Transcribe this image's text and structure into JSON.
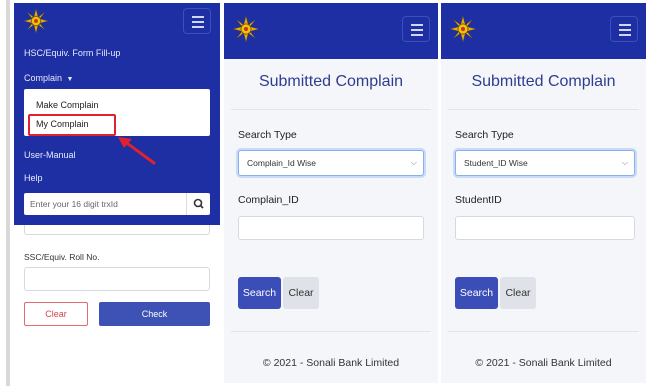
{
  "panel1": {
    "nav_links": {
      "form_fillup": "HSC/Equiv. Form Fill-up",
      "complain": "Complain",
      "user_manual": "User-Manual",
      "help": "Help"
    },
    "dropdown_items": [
      "Make Complain",
      "My Complain"
    ],
    "search_placeholder": "Enter your 16 digit trxId",
    "roll_label": "SSC/Equiv. Roll No.",
    "clear_label": "Clear",
    "check_label": "Check"
  },
  "panel2": {
    "title": "Submitted Complain",
    "search_type_label": "Search Type",
    "search_type_value": "Complain_Id Wise",
    "id_label": "Complain_ID",
    "search_label": "Search",
    "clear_label": "Clear",
    "footer": "© 2021 - Sonali Bank Limited"
  },
  "panel3": {
    "title": "Submitted Complain",
    "search_type_label": "Search Type",
    "search_type_value": "Student_ID Wise",
    "id_label": "StudentID",
    "search_label": "Search",
    "clear_label": "Clear",
    "footer": "© 2021 - Sonali Bank Limited"
  },
  "colors": {
    "navbar": "#1d2fa3",
    "primary_button": "#3b4db7",
    "highlight": "#e0212e",
    "title": "#2f3d8f"
  },
  "icons": {
    "logo": "sonali-bank-logo-icon",
    "menu": "hamburger-icon",
    "search": "magnifier-icon",
    "caret": "caret-down-icon",
    "select": "chevron-down-icon",
    "pointer": "red-arrow-icon"
  }
}
